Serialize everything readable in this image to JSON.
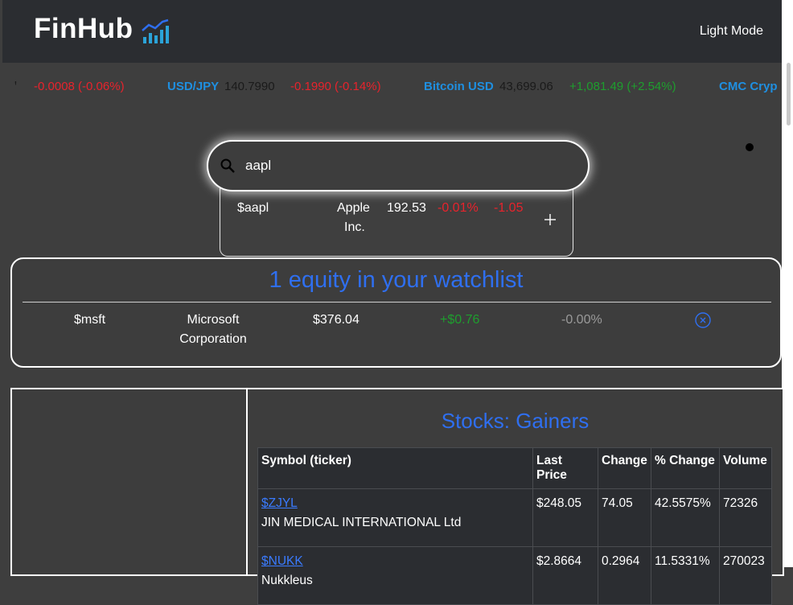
{
  "navbar": {
    "brand": "FinHub",
    "brand_icon": "bar-chart-trend-icon",
    "mode_toggle": "Light Mode"
  },
  "ticker": {
    "items": [
      {
        "name": "",
        "price": "",
        "change": "-0.0008 (-0.06%)",
        "direction": "down"
      },
      {
        "name": "USD/JPY",
        "price": "140.7990",
        "change": "-0.1990 (-0.14%)",
        "direction": "down"
      },
      {
        "name": "Bitcoin USD",
        "price": "43,699.06",
        "change": "+1,081.49 (+2.54%)",
        "direction": "up"
      },
      {
        "name": "CMC Cryp",
        "price": "",
        "change": "",
        "direction": ""
      }
    ]
  },
  "search": {
    "value": "aapl",
    "icon": "search-icon",
    "results": [
      {
        "symbol": "$aapl",
        "name_line1": "Apple",
        "name_line2": "Inc.",
        "price": "192.53",
        "pct_change": "-0.01%",
        "change": "-1.05",
        "action_icon": "plus-icon"
      }
    ]
  },
  "watchlist": {
    "title": "1 equity in your watchlist",
    "items": [
      {
        "symbol": "$msft",
        "name_line1": "Microsoft",
        "name_line2": "Corporation",
        "price": "$376.04",
        "change": "+$0.76",
        "pct_change": "-0.00%",
        "action_icon": "remove-circle-icon"
      }
    ]
  },
  "gainers": {
    "title": "Stocks: Gainers",
    "columns": [
      "Symbol (ticker)",
      "Last Price",
      "Change",
      "% Change",
      "Volume"
    ],
    "rows": [
      {
        "symbol": "$ZJYL",
        "company": "JIN MEDICAL INTERNATIONAL Ltd",
        "last_price": "$248.05",
        "change": "74.05",
        "pct_change": "42.5575%",
        "volume": "72326"
      },
      {
        "symbol": "$NUKK",
        "company": "Nukkleus",
        "last_price": "$2.8664",
        "change": "0.2964",
        "pct_change": "11.5331%",
        "volume": "270023"
      }
    ]
  },
  "colors": {
    "accent_blue": "#2f6ff0",
    "ticker_name": "#1f8fe0",
    "negative": "#e8232c",
    "positive": "#1e9e2e"
  }
}
